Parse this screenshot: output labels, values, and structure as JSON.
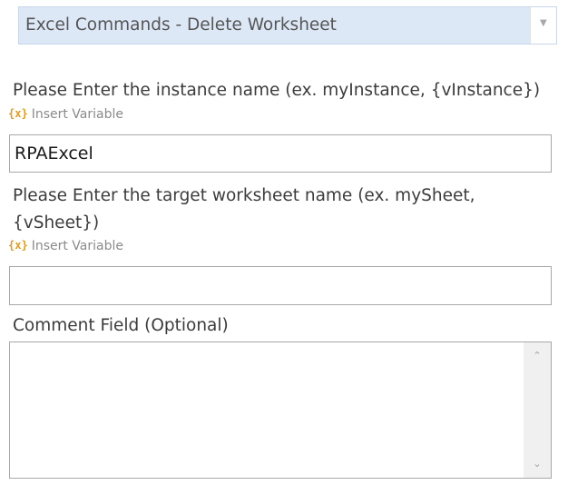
{
  "command_select": {
    "value": "Excel Commands - Delete Worksheet",
    "arrow_icon": "chevron-down-icon"
  },
  "instance_field": {
    "label": "Please Enter the instance name (ex. myInstance, {vInstance})",
    "insert_variable_label": "Insert Variable",
    "value": "RPAExcel"
  },
  "worksheet_field": {
    "label_line1": "Please Enter the target worksheet name (ex. mySheet,",
    "label_line2": "{vSheet})",
    "insert_variable_label": "Insert Variable",
    "value": ""
  },
  "comment_field": {
    "label": "Comment Field (Optional)",
    "value": ""
  },
  "icons": {
    "variable": "{x}",
    "scroll_up": "^",
    "scroll_down": "v"
  },
  "colors": {
    "dropdown_bg": "#dde8f7",
    "variable_icon": "#e39a1a",
    "border": "#a8a8a8"
  }
}
